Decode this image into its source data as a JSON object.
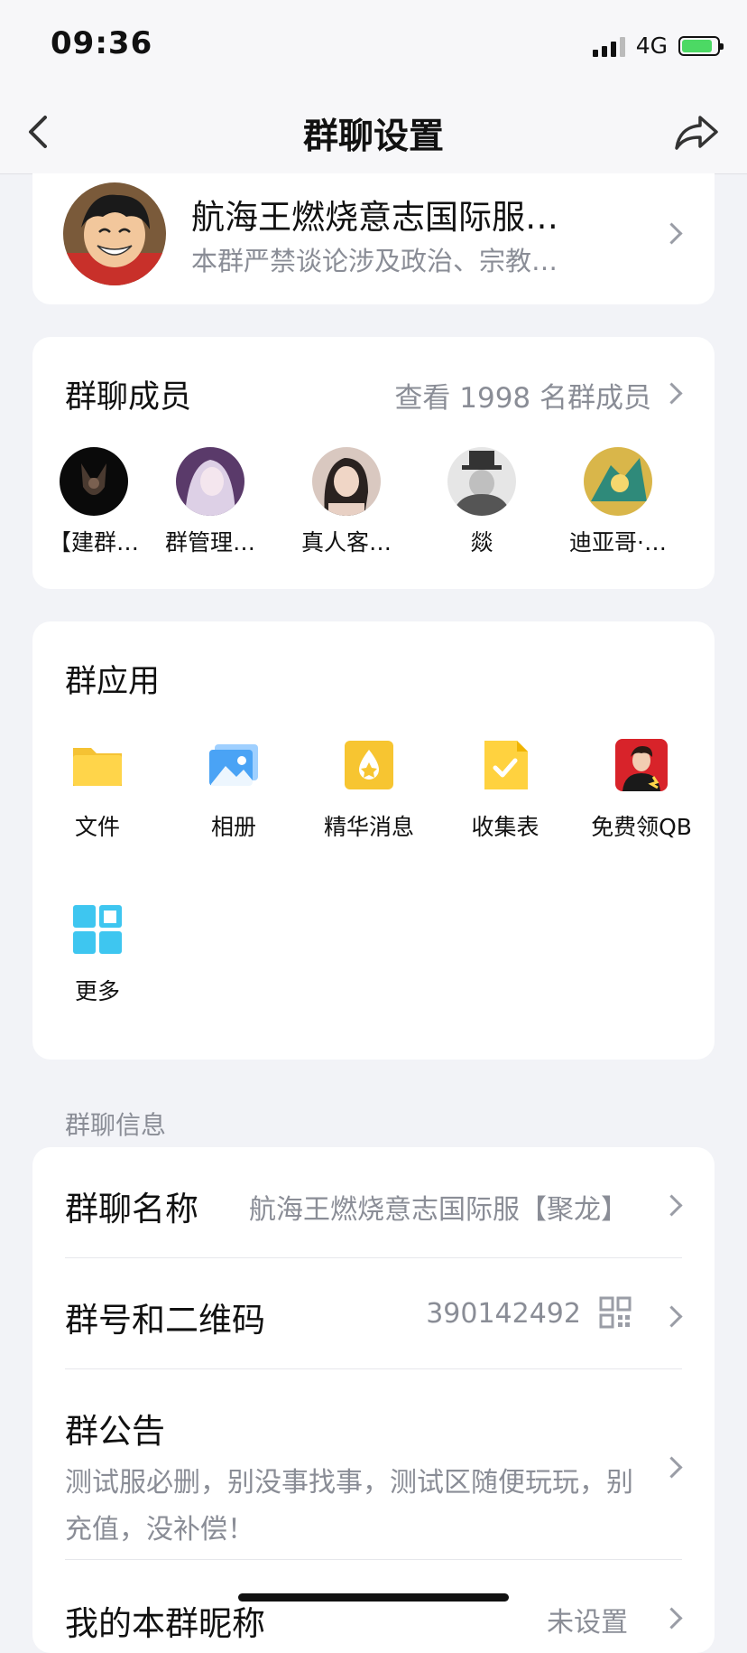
{
  "status_bar": {
    "time": "09:36",
    "network": "4G"
  },
  "nav": {
    "title": "群聊设置"
  },
  "group": {
    "name": "航海王燃烧意志国际服…",
    "description": "本群严禁谈论涉及政治、宗教…"
  },
  "members": {
    "title": "群聊成员",
    "view_all": "查看 1998 名群成员",
    "items": [
      {
        "name": "【建群…"
      },
      {
        "name": "群管理…"
      },
      {
        "name": "真人客…"
      },
      {
        "name": "燚"
      },
      {
        "name": "迪亚哥·…"
      }
    ]
  },
  "apps": {
    "title": "群应用",
    "items": [
      {
        "label": "文件",
        "icon": "folder-icon"
      },
      {
        "label": "相册",
        "icon": "photo-album-icon"
      },
      {
        "label": "精华消息",
        "icon": "essence-icon"
      },
      {
        "label": "收集表",
        "icon": "form-icon"
      },
      {
        "label": "免费领QB",
        "icon": "promo-icon"
      },
      {
        "label": "更多",
        "icon": "grid-icon"
      }
    ]
  },
  "info": {
    "caption": "群聊信息",
    "name_label": "群聊名称",
    "name_value": "航海王燃烧意志国际服【聚龙】",
    "number_label": "群号和二维码",
    "number_value": "390142492",
    "notice_label": "群公告",
    "notice_text": "测试服必删，别没事找事，测试区随便玩玩，别充值，没补偿！",
    "nickname_label": "我的本群昵称",
    "nickname_value": "未设置"
  }
}
